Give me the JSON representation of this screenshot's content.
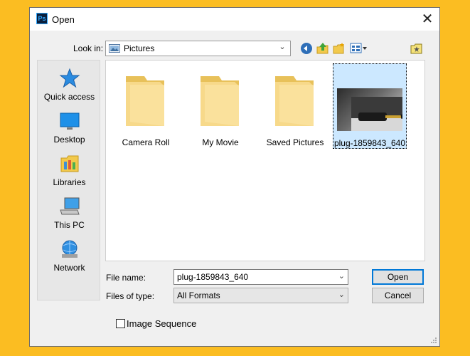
{
  "window": {
    "title": "Open",
    "app_icon_text": "Ps"
  },
  "lookin": {
    "label": "Look in:",
    "value": "Pictures"
  },
  "toolbar": {
    "icons": [
      "back-icon",
      "up-folder-icon",
      "new-folder-icon",
      "view-menu-icon",
      "favorites-folder-icon"
    ]
  },
  "places": [
    {
      "label": "Quick access",
      "icon": "star-icon"
    },
    {
      "label": "Desktop",
      "icon": "desktop-icon"
    },
    {
      "label": "Libraries",
      "icon": "libraries-icon"
    },
    {
      "label": "This PC",
      "icon": "computer-icon"
    },
    {
      "label": "Network",
      "icon": "network-icon"
    }
  ],
  "files": [
    {
      "name": "Camera Roll",
      "type": "folder"
    },
    {
      "name": "My Movie",
      "type": "folder"
    },
    {
      "name": "Saved Pictures",
      "type": "folder"
    },
    {
      "name": "plug-1859843_640",
      "type": "image",
      "selected": true
    }
  ],
  "filename": {
    "label": "File name:",
    "value": "plug-1859843_640"
  },
  "filetype": {
    "label": "Files of type:",
    "value": "All Formats"
  },
  "buttons": {
    "open": "Open",
    "cancel": "Cancel"
  },
  "image_sequence": {
    "label": "Image Sequence",
    "checked": false
  },
  "colors": {
    "background": "#fbbd22",
    "selection": "#cce8ff",
    "accent": "#0078d7"
  }
}
